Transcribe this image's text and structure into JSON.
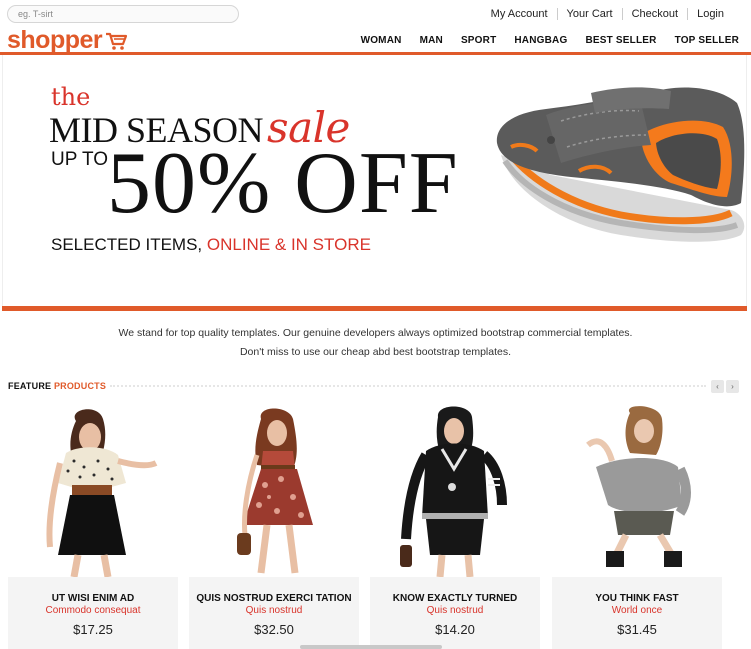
{
  "search": {
    "placeholder": "eg. T-sirt"
  },
  "toplinks": [
    "My Account",
    "Your Cart",
    "Checkout",
    "Login"
  ],
  "brand": {
    "name": "shopper",
    "color": "#e05a2a"
  },
  "nav": [
    "WOMAN",
    "MAN",
    "SPORT",
    "HANGBAG",
    "BEST SELLER",
    "TOP SELLER"
  ],
  "hero": {
    "the": "the",
    "mid": "MID SEASON",
    "sale": "sale",
    "upto": "UP TO",
    "off": "50% OFF",
    "selected": "SELECTED ITEMS,",
    "online": "ONLINE & IN STORE"
  },
  "tagline": {
    "line1": "We stand for top quality templates. Our genuine developers always optimized bootstrap commercial templates.",
    "line2": "Don't miss to use our cheap abd best bootstrap templates."
  },
  "feature": {
    "label": "FEATURE",
    "highlight": "PRODUCTS"
  },
  "products": [
    {
      "name": "UT WISI ENIM AD",
      "sub": "Commodo consequat",
      "price": "$17.25"
    },
    {
      "name": "QUIS NOSTRUD EXERCI TATION",
      "sub": "Quis nostrud",
      "price": "$32.50"
    },
    {
      "name": "KNOW EXACTLY TURNED",
      "sub": "Quis nostrud",
      "price": "$14.20"
    },
    {
      "name": "YOU THINK FAST",
      "sub": "World once",
      "price": "$31.45"
    }
  ],
  "colors": {
    "accent": "#e05a2a",
    "sale_red": "#d9342b"
  }
}
